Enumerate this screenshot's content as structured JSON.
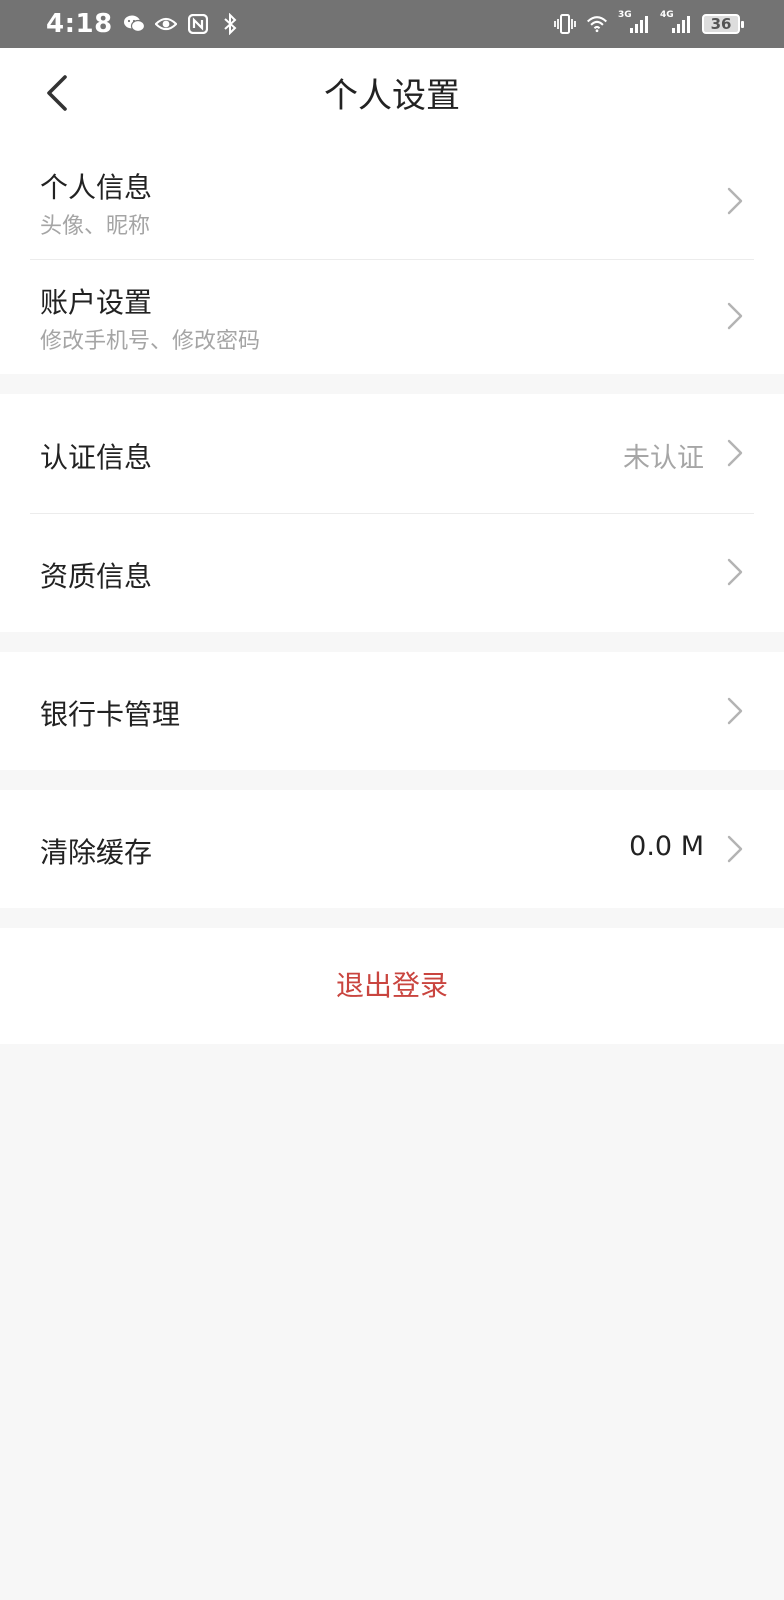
{
  "status_bar": {
    "time": "4:18",
    "left_icons": [
      "wechat-icon",
      "eye-icon",
      "nfc-icon",
      "bluetooth-icon"
    ],
    "right_icons": [
      "vibrate-icon",
      "wifi-icon",
      "signal-3g-icon",
      "signal-4g-icon"
    ],
    "net_3g": "3G",
    "net_4g": "4G",
    "battery": "36"
  },
  "header": {
    "title": "个人设置",
    "back_icon": "chevron-left-icon"
  },
  "groups": {
    "profile": {
      "personal_info": {
        "title": "个人信息",
        "subtitle": "头像、昵称"
      },
      "account_settings": {
        "title": "账户设置",
        "subtitle": "修改手机号、修改密码"
      }
    },
    "verification": {
      "auth_info": {
        "title": "认证信息",
        "value": "未认证"
      },
      "qualification_info": {
        "title": "资质信息"
      }
    },
    "bank": {
      "bank_card": {
        "title": "银行卡管理"
      }
    },
    "cache": {
      "clear_cache": {
        "title": "清除缓存",
        "value": "0.0 M"
      }
    }
  },
  "logout": {
    "label": "退出登录"
  },
  "colors": {
    "status_bar_bg": "#737373",
    "page_bg": "#f7f7f7",
    "card_bg": "#ffffff",
    "logout_red": "#c9453f",
    "secondary_text": "#a5a5a5",
    "chevron": "#b3b3b3"
  },
  "row_icon": "chevron-right-icon"
}
